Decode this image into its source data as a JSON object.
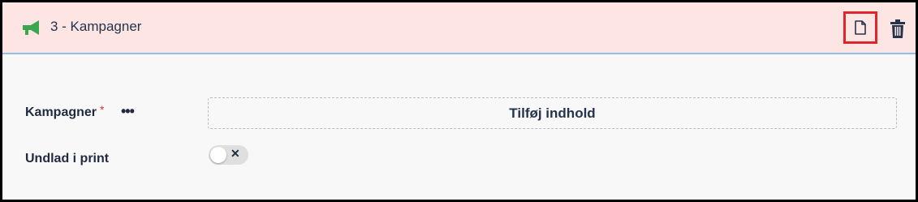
{
  "header": {
    "title": "3 - Kampagner",
    "icon": "megaphone-icon",
    "actions": [
      {
        "icon": "copy-document-icon",
        "highlighted": true,
        "highlight_color": "#e0262b"
      },
      {
        "icon": "trash-icon"
      }
    ],
    "background": "#fde5e3",
    "icon_color": "#3aa64f"
  },
  "fields": {
    "campaigns": {
      "label": "Kampagner",
      "required_mark": "*",
      "more_label": "•••",
      "add_content_label": "Tilføj indhold"
    },
    "exclude_print": {
      "label": "Undlad i print",
      "toggle_state": "off",
      "toggle_symbol": "✕"
    }
  }
}
